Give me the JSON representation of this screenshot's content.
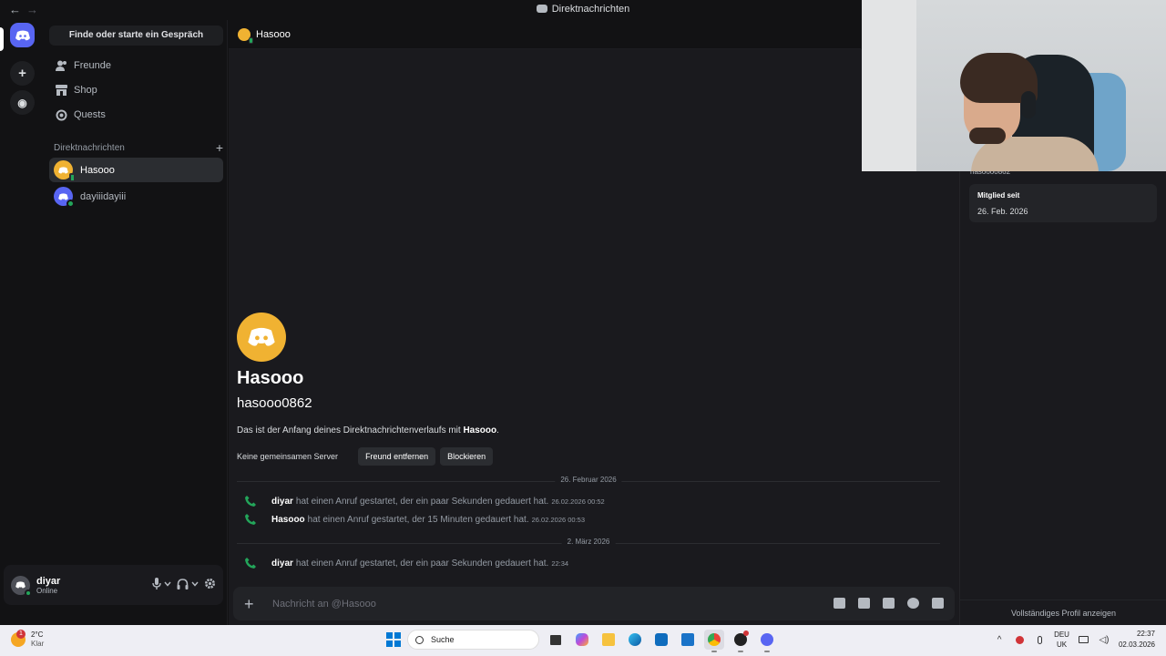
{
  "window": {
    "title": "Direktnachrichten",
    "back": "←",
    "forward": "→"
  },
  "rail": {
    "add_label": "+",
    "explore_label": "◉"
  },
  "sidebar": {
    "search_label": "Finde oder starte ein Gespräch",
    "nav": [
      {
        "label": "Freunde",
        "icon": "friends-icon"
      },
      {
        "label": "Shop",
        "icon": "shop-icon"
      },
      {
        "label": "Quests",
        "icon": "quests-icon"
      }
    ],
    "dm_header": "Direktnachrichten",
    "dm_add": "+",
    "dms": [
      {
        "name": "Hasooo",
        "avatar_color": "#f0b232",
        "active": true
      },
      {
        "name": "dayiiidayiii",
        "avatar_color": "#5865f2",
        "active": false
      }
    ]
  },
  "user": {
    "name": "diyar",
    "status": "Online"
  },
  "chat": {
    "header_name": "Hasooo",
    "display_name": "Hasooo",
    "username": "hasooo0862",
    "intro_prefix": "Das ist der Anfang deines Direktnachrichtenverlaufs mit ",
    "intro_name": "Hasooo",
    "intro_suffix": ".",
    "no_servers": "Keine gemeinsamen Server",
    "remove_friend": "Freund entfernen",
    "block": "Blockieren",
    "date1": "26. Februar 2026",
    "date2": "2. März 2026",
    "calls": [
      {
        "who": "diyar",
        "text": "hat einen Anruf gestartet, der ein paar Sekunden gedauert hat.",
        "ts": "26.02.2026 00:52"
      },
      {
        "who": "Hasooo",
        "text": "hat einen Anruf gestartet, der 15 Minuten gedauert hat.",
        "ts": "26.02.2026 00:53"
      },
      {
        "who": "diyar",
        "text": "hat einen Anruf gestartet, der ein paar Sekunden gedauert hat.",
        "ts": "22:34"
      }
    ],
    "placeholder": "Nachricht an @Hasooo"
  },
  "profile": {
    "username_cut": "hasooo0862",
    "member_since_label": "Mitglied seit",
    "member_since": "26. Feb. 2026",
    "full_profile": "Vollständiges Profil anzeigen"
  },
  "taskbar": {
    "weather_temp": "2°C",
    "weather_desc": "Klar",
    "weather_badge": "1",
    "search": "Suche",
    "lang1": "DEU",
    "lang2": "UK",
    "time": "22:37",
    "date": "02.03.2026"
  },
  "colors": {
    "accent": "#5865f2",
    "online": "#23a55a",
    "avatar_hasooo": "#f0b232"
  }
}
